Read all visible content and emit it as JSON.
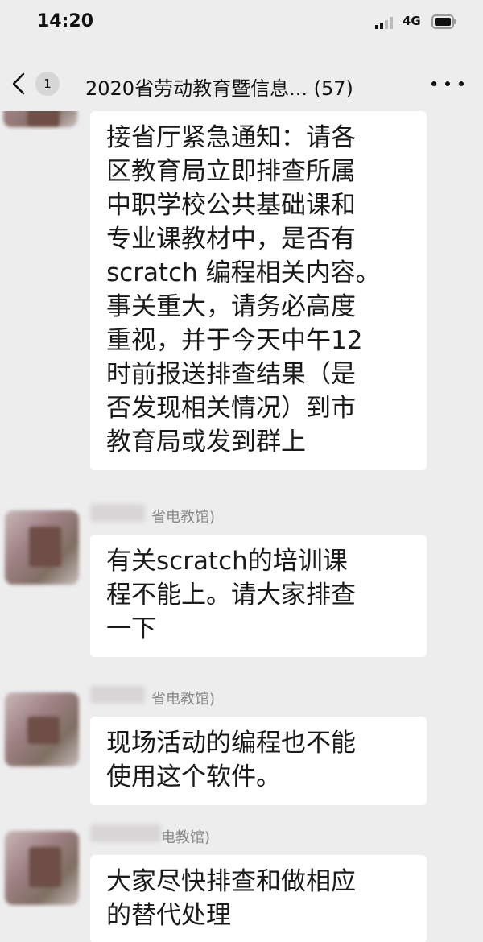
{
  "status_bar": {
    "time": "14:20",
    "network": "4G",
    "icons": [
      "signal-icon",
      "battery-icon"
    ]
  },
  "nav": {
    "back_icon": "chevron-left-icon",
    "unread_count": "1",
    "title": "2020省劳动教育暨信息... (57)",
    "more_icon": "more-dots-icon"
  },
  "messages": [
    {
      "sender": "",
      "text": "接省厅紧急通知：请各\n区教育局立即排查所属\n中职学校公共基础课和\n专业课教材中，是否有\nscratch 编程相关内容。\n事关重大，请务必高度\n重视，并于今天中午12\n时前报送排查结果（是\n否发现相关情况）到市\n教育局或发到群上"
    },
    {
      "sender": "省电教馆)",
      "text": "有关scratch的培训课\n程不能上。请大家排查\n一下"
    },
    {
      "sender": "省电教馆)",
      "text": "现场活动的编程也不能\n使用这个软件。"
    },
    {
      "sender": "电教馆)",
      "text": "大家尽快排查和做相应\n的替代处理"
    }
  ],
  "colors": {
    "background": "#ededed",
    "bubble": "#ffffff",
    "sender_name": "#888888"
  }
}
